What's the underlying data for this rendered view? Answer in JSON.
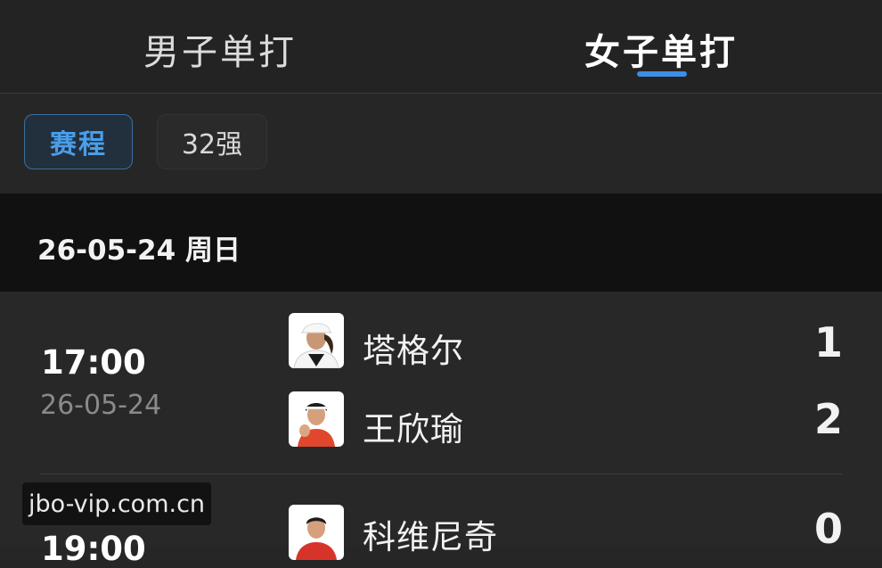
{
  "tabs": {
    "men_singles": "男子单打",
    "women_singles": "女子单打",
    "accent": "#3c8ee6"
  },
  "subtabs": {
    "schedule": "赛程",
    "top32": "32强"
  },
  "date_header": "26-05-24 周日",
  "matches": [
    {
      "time": "17:00",
      "date": "26-05-24",
      "players": [
        {
          "name": "塔格尔",
          "score": "1",
          "avatar_icon": "player-avatar-white-cap"
        },
        {
          "name": "王欣瑜",
          "score": "2",
          "avatar_icon": "player-avatar-red-top"
        }
      ]
    },
    {
      "time": "19:00",
      "players": [
        {
          "name": "科维尼奇",
          "score": "0",
          "avatar_icon": "player-avatar-red-top"
        }
      ]
    }
  ],
  "watermark": "jbo-vip.com.cn"
}
